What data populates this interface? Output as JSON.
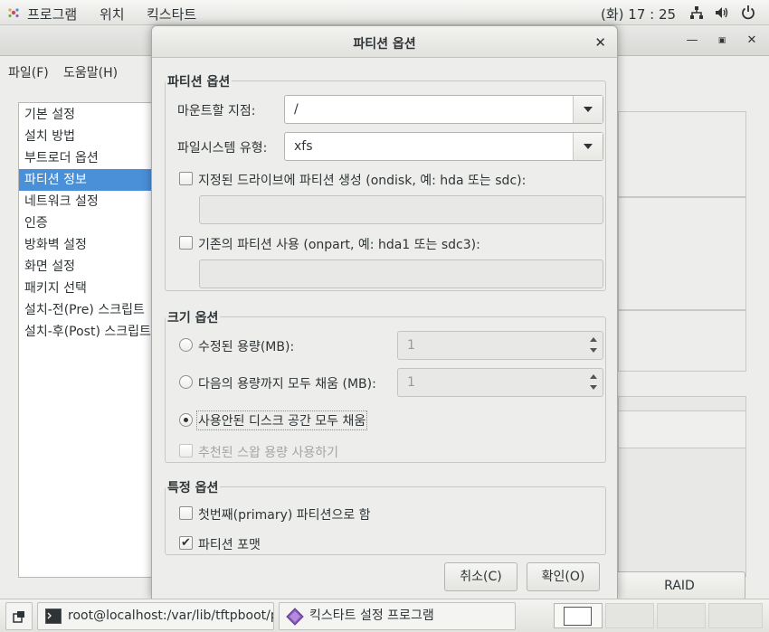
{
  "top_panel": {
    "applications": "프로그램",
    "places": "위치",
    "active_app": "킥스타트",
    "clock": "(화) 17 : 25"
  },
  "app": {
    "menu": {
      "file": "파일(F)",
      "help": "도움말(H)"
    },
    "sidebar": {
      "items": [
        "기본 설정",
        "설치 방법",
        "부트로더 옵션",
        "파티션 정보",
        "네트워크 설정",
        "인증",
        "방화벽 설정",
        "화면 설정",
        "패키지 선택",
        "설치-전(Pre) 스크립트",
        "설치-후(Post) 스크립트"
      ],
      "selected": "파티션 정보"
    },
    "raid_button": "RAID"
  },
  "dialog": {
    "title": "파티션 옵션",
    "partition_options": {
      "heading": "파티션 옵션",
      "mount_point_label": "마운트할 지점:",
      "mount_point_value": "/",
      "fs_type_label": "파일시스템 유형:",
      "fs_type_value": "xfs",
      "ondisk_label": "지정된 드라이브에 파티션 생성 (ondisk, 예: hda 또는 sdc):",
      "onpart_label": "기존의 파티션 사용 (onpart, 예: hda1 또는 sdc3):"
    },
    "size_options": {
      "heading": "크기 옵션",
      "fixed_label": "수정된 용량(MB):",
      "fixed_value": "1",
      "grow_to_label": "다음의 용량까지 모두 채움 (MB):",
      "grow_to_value": "1",
      "fill_label": "사용안된 디스크 공간 모두 채움",
      "swap_label": "추천된 스왑 용량 사용하기",
      "selected": "fill"
    },
    "specific_options": {
      "heading": "특정 옵션",
      "primary_label": "첫번째(primary) 파티션으로 함",
      "primary_checked": false,
      "format_label": "파티션 포맷",
      "format_checked": true
    },
    "cancel_button": "취소(C)",
    "ok_button": "확인(O)"
  },
  "taskbar": {
    "terminal_task": "root@localhost:/var/lib/tftpboot/px…",
    "kickstart_task": "킥스타트 설정 프로그램"
  }
}
